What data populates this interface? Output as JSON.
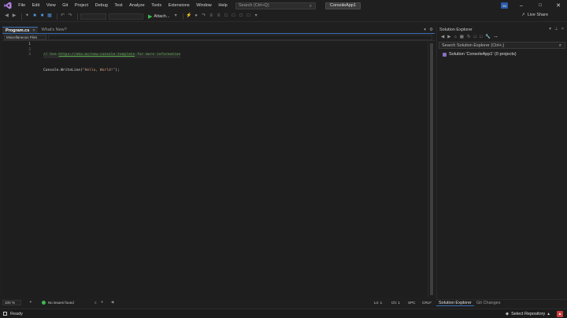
{
  "menu": [
    "File",
    "Edit",
    "View",
    "Git",
    "Project",
    "Debug",
    "Test",
    "Analyze",
    "Tools",
    "Extensions",
    "Window",
    "Help"
  ],
  "search": {
    "placeholder": "Search (Ctrl+Q)"
  },
  "solution_name": "ConsoleApp1",
  "user_initials": "YH",
  "toolbar": {
    "attach_label": "Attach...",
    "live_share_label": "Live Share"
  },
  "editor": {
    "tabs": [
      {
        "label": "Program.cs",
        "active": true
      },
      {
        "label": "What's New?",
        "active": false
      }
    ],
    "nav_scope": "Miscellaneous Files",
    "line_numbers": [
      "1",
      "2",
      "3"
    ],
    "code": {
      "line1_comment_prefix": "// See ",
      "line1_link": "https://aka.ms/new-console-template",
      "line1_comment_suffix": " for more information",
      "line2_ident": "Console.WriteLine(",
      "line2_string": "\"Hello, World!\"",
      "line2_end": ");"
    }
  },
  "editor_status": {
    "zoom": "100 %",
    "issues": "No issues found",
    "line": "Ln: 1",
    "col": "Ch: 1",
    "mode": "SPC",
    "eol": "CRLF"
  },
  "solution_explorer": {
    "title": "Solution Explorer",
    "search_placeholder": "Search Solution Explorer (Ctrl+;)",
    "solution_item": "Solution 'ConsoleApp1' (0 projects)",
    "tabs": [
      "Solution Explorer",
      "Git Changes"
    ]
  },
  "statusbar": {
    "ready": "Ready",
    "repo": "Select Repository"
  },
  "colors": {
    "accent": "#3b6fb6",
    "comment": "#57a64a",
    "string": "#d69d85",
    "ok": "#3fb950",
    "notification": "#c93c3c"
  }
}
